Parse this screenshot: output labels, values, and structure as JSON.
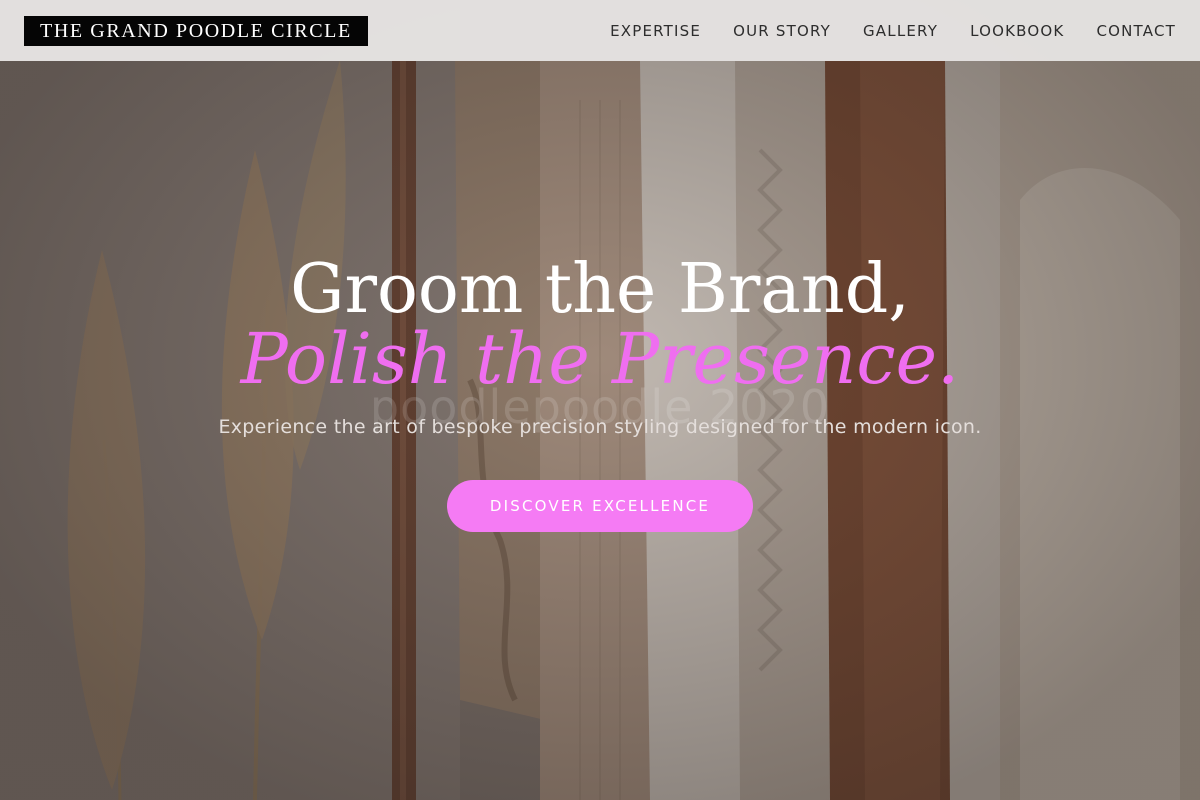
{
  "brand": {
    "name": "THE GRAND POODLE CIRCLE"
  },
  "nav": {
    "items": [
      {
        "label": "EXPERTISE"
      },
      {
        "label": "OUR STORY"
      },
      {
        "label": "GALLERY"
      },
      {
        "label": "LOOKBOOK"
      },
      {
        "label": "CONTACT"
      }
    ]
  },
  "hero": {
    "headline": "Groom the Brand,",
    "headline_accent": "Polish the Presence.",
    "ghost_text": "poodlepoodle 2020",
    "subline": "Experience the art of bespoke precision styling designed for the modern icon.",
    "cta_label": "DISCOVER EXCELLENCE"
  },
  "colors": {
    "accent": "#f57bf4",
    "accent_text": "#ef6ef0",
    "header_bg": "#ecebea",
    "logo_bg": "#050505"
  }
}
